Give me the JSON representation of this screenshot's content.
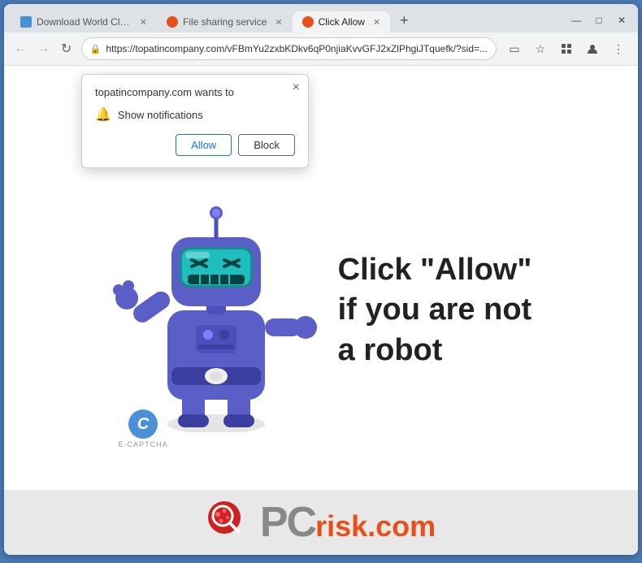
{
  "browser": {
    "tabs": [
      {
        "id": "tab1",
        "label": "Download World Clock",
        "active": false,
        "favicon_color": "#4a90d9"
      },
      {
        "id": "tab2",
        "label": "File sharing service",
        "active": false,
        "favicon_color": "#e8501a"
      },
      {
        "id": "tab3",
        "label": "Click Allow",
        "active": true,
        "favicon_color": "#e8501a"
      }
    ],
    "new_tab_label": "+",
    "window_controls": [
      "∧",
      "—",
      "□",
      "✕"
    ],
    "address": "https://topatincompany.com/vFBmYu2zxbKDkv6qP0njiaKvvGFJ2xZlPhgiJTquefk/?sid=...",
    "nav": {
      "back_label": "←",
      "forward_label": "→",
      "reload_label": "↻"
    }
  },
  "nav_icons": {
    "bookmark": "☆",
    "profile": "⬤",
    "menu": "⋮",
    "cast": "▭",
    "extensions": "🧩"
  },
  "popup": {
    "title": "topatincompany.com wants to",
    "notification_text": "Show notifications",
    "allow_label": "Allow",
    "block_label": "Block",
    "close_label": "×"
  },
  "page": {
    "main_text_line1": "Click \"Allow\"",
    "main_text_line2": "if you are not",
    "main_text_line3": "a robot"
  },
  "captcha": {
    "letter": "C",
    "label": "E-CAPTCHA"
  },
  "pcrisk": {
    "pc_text": "PC",
    "risk_text": "risk",
    "com_text": ".com"
  }
}
